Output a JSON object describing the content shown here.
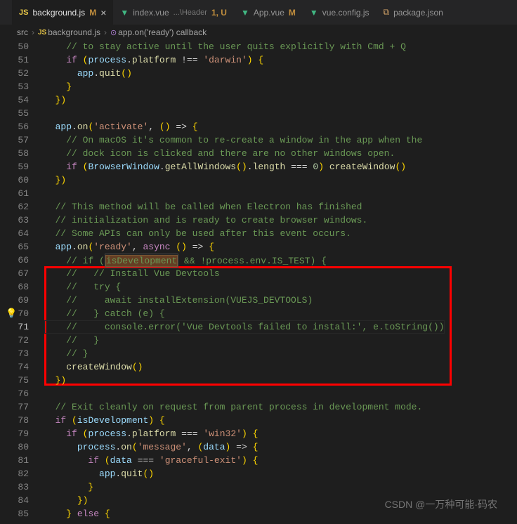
{
  "tabs": [
    {
      "icon": "JS",
      "name": "background.js",
      "badge": "M",
      "close": "×",
      "active": true
    },
    {
      "icon": "V",
      "name": "index.vue",
      "subpath": "...\\Header",
      "badge": "1, U",
      "badgeClass": "num"
    },
    {
      "icon": "V",
      "name": "App.vue",
      "badge": "M"
    },
    {
      "icon": "V",
      "name": "vue.config.js",
      "iconClass": "gear"
    },
    {
      "icon": "{}",
      "name": "package.json",
      "iconClass": "json"
    }
  ],
  "breadcrumb": {
    "parts": [
      "src",
      "background.js",
      "app.on('ready') callback"
    ]
  },
  "startLine": 50,
  "currentLine": 71,
  "watermark": "CSDN @一万种可能·码农",
  "code": [
    "    // to stay active until the user quits explicitly with Cmd + Q",
    "    if (process.platform !== 'darwin') {",
    "      app.quit()",
    "    }",
    "  })",
    "",
    "  app.on('activate', () => {",
    "    // On macOS it's common to re-create a window in the app when the",
    "    // dock icon is clicked and there are no other windows open.",
    "    if (BrowserWindow.getAllWindows().length === 0) createWindow()",
    "  })",
    "",
    "  // This method will be called when Electron has finished",
    "  // initialization and is ready to create browser windows.",
    "  // Some APIs can only be used after this event occurs.",
    "  app.on('ready', async () => {",
    "    // if (isDevelopment && !process.env.IS_TEST) {",
    "    //   // Install Vue Devtools",
    "    //   try {",
    "    //     await installExtension(VUEJS_DEVTOOLS)",
    "    //   } catch (e) {",
    "    //     console.error('Vue Devtools failed to install:', e.toString())",
    "    //   }",
    "    // }",
    "    createWindow()",
    "  })",
    "",
    "  // Exit cleanly on request from parent process in development mode.",
    "  if (isDevelopment) {",
    "    if (process.platform === 'win32') {",
    "      process.on('message', (data) => {",
    "        if (data === 'graceful-exit') {",
    "          app.quit()",
    "        }",
    "      })",
    "    } else {"
  ]
}
